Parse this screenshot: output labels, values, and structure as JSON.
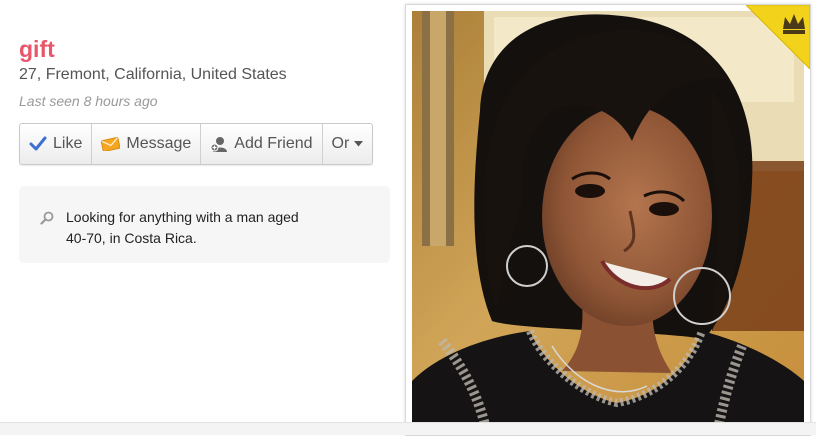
{
  "profile": {
    "name": "gift",
    "location": "27, Fremont, California, United States",
    "last_seen": "Last seen 8 hours ago"
  },
  "actions": {
    "like": "Like",
    "message": "Message",
    "add_friend": "Add Friend",
    "or": "Or"
  },
  "looking_for": {
    "text": "Looking for anything with a man aged 40-70, in Costa Rica."
  },
  "icons": {
    "like": "check-icon",
    "message": "envelope-icon",
    "add_friend": "person-add-icon",
    "or": "caret-down-icon",
    "looking": "search-icon",
    "badge": "crown-icon"
  },
  "colors": {
    "name": "#e9566a",
    "like_check": "#3b6fd1",
    "message_envelope": "#f5a623",
    "crown_badge": "#f2d21b"
  }
}
